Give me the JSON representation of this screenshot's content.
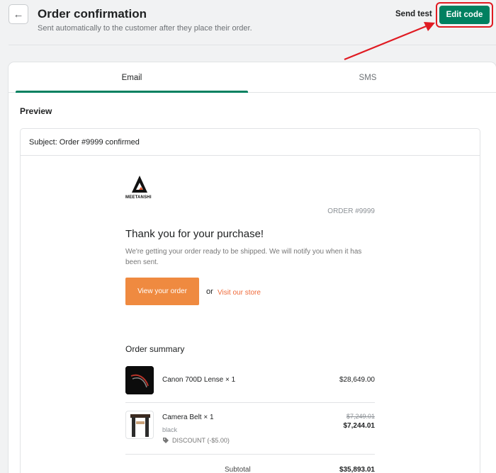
{
  "header": {
    "title": "Order confirmation",
    "subtitle": "Sent automatically to the customer after they place their order.",
    "send_test_label": "Send test",
    "edit_code_label": "Edit code"
  },
  "tabs": [
    {
      "label": "Email",
      "active": true
    },
    {
      "label": "SMS",
      "active": false
    }
  ],
  "preview": {
    "label": "Preview",
    "subject": "Subject: Order #9999 confirmed"
  },
  "email": {
    "logo_text": "MEETANSHI",
    "order_number": "ORDER #9999",
    "heading": "Thank you for your purchase!",
    "note": "We're getting your order ready to be shipped. We will notify you when it has been sent.",
    "view_order_label": "View your order",
    "or_text": "or",
    "visit_store_label": "Visit our store",
    "summary_title": "Order summary",
    "items": [
      {
        "name": "Canon 700D Lense × 1",
        "price": "$28,649.00"
      },
      {
        "name": "Camera Belt × 1",
        "variant": "black",
        "discount": "DISCOUNT (-$5.00)",
        "old_price": "$7,249.01",
        "price": "$7,244.01"
      }
    ],
    "subtotal_label": "Subtotal",
    "subtotal_value": "$35,893.01"
  },
  "colors": {
    "primary_button": "#008060",
    "highlight_border": "#e01b22",
    "email_button": "#ef8a40",
    "store_link": "#ef6a3a"
  }
}
